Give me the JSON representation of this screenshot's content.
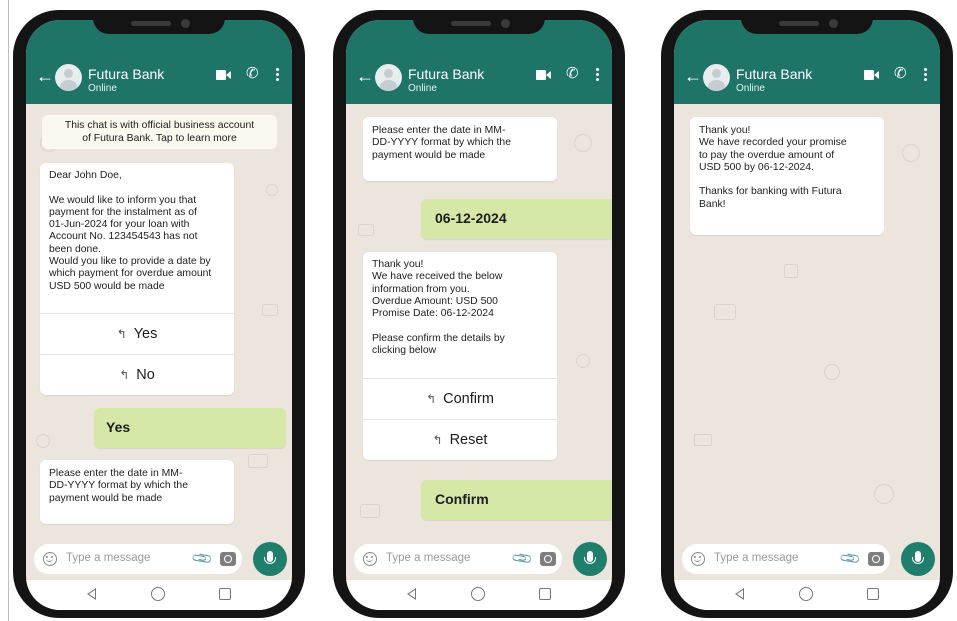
{
  "colors": {
    "header": "#1f7468",
    "chat_bg": "#ece5dd",
    "sent_bubble": "#d5e8a8",
    "mic": "#1f7e6c"
  },
  "common": {
    "contact_name": "Futura Bank",
    "contact_status": "Online",
    "input_placeholder": "Type a message",
    "icons": [
      "back-arrow-icon",
      "avatar",
      "video-call-icon",
      "phone-icon",
      "menu-icon",
      "emoji-icon",
      "attach-icon",
      "camera-icon",
      "mic-icon",
      "nav-back-icon",
      "nav-home-icon",
      "nav-recent-icon"
    ]
  },
  "phone1": {
    "notice": "This chat is with official business account\nof Futura Bank. Tap to learn more",
    "msg1": "Dear John Doe,\n\nWe would like to inform you that\npayment for the instalment as of\n01-Jun-2024 for your loan with\nAccount No. 123454543 has not\nbeen done.\nWould you like to provide a date by\nwhich payment for overdue amount\nUSD 500 would be made",
    "reply_yes": "Yes",
    "reply_no": "No",
    "sent1": "Yes",
    "msg2": "Please enter the date in MM-\nDD-YYYY format by which the\npayment would be made"
  },
  "phone2": {
    "msg1": "Please enter the date in MM-\nDD-YYYY format by which the\npayment would be made",
    "sent1": "06-12-2024",
    "msg2": "Thank you!\nWe have received the below\ninformation from you.\nOverdue Amount: USD 500\nPromise Date: 06-12-2024\n\nPlease confirm the details by\nclicking below",
    "reply_confirm": "Confirm",
    "reply_reset": "Reset",
    "sent2": "Confirm"
  },
  "phone3": {
    "msg1": "Thank you!\nWe have recorded your promise\nto pay the overdue amount of\nUSD 500 by 06-12-2024.\n\nThanks for banking with Futura\nBank!"
  }
}
